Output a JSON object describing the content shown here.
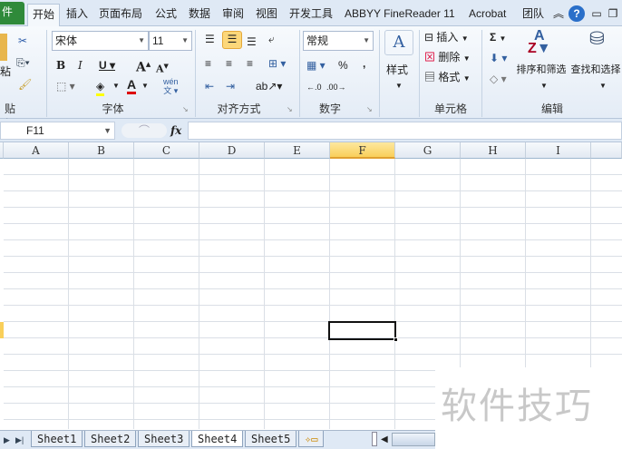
{
  "tabs": {
    "file": "件",
    "items": [
      "开始",
      "插入",
      "页面布局",
      "公式",
      "数据",
      "审阅",
      "视图",
      "开发工具",
      "ABBYY FineReader 11",
      "Acrobat",
      "团队"
    ]
  },
  "ribbon": {
    "clipboard": {
      "paste": "粘",
      "label": "贴板"
    },
    "font": {
      "name": "宋体",
      "size": "11",
      "label": "字体",
      "phonetic": "wén"
    },
    "alignment": {
      "label": "对齐方式"
    },
    "number": {
      "format": "常规",
      "percent": "%",
      "comma": ",",
      "label": "数字"
    },
    "styles": {
      "label": "样式"
    },
    "cells": {
      "insert": "插入",
      "delete": "删除",
      "format": "格式",
      "label": "单元格"
    },
    "editing": {
      "sum": "Σ",
      "sort": "排序和筛选",
      "find": "查找和选择",
      "label": "编辑"
    }
  },
  "formula_bar": {
    "name_box": "F11",
    "fx": "fx",
    "formula": ""
  },
  "columns": [
    "A",
    "B",
    "C",
    "D",
    "E",
    "F",
    "G",
    "H",
    "I"
  ],
  "selected_cell": "F11",
  "sheets": [
    "Sheet1",
    "Sheet2",
    "Sheet3",
    "Sheet4",
    "Sheet5"
  ],
  "active_sheet": "Sheet4",
  "watermark": "软件技巧"
}
